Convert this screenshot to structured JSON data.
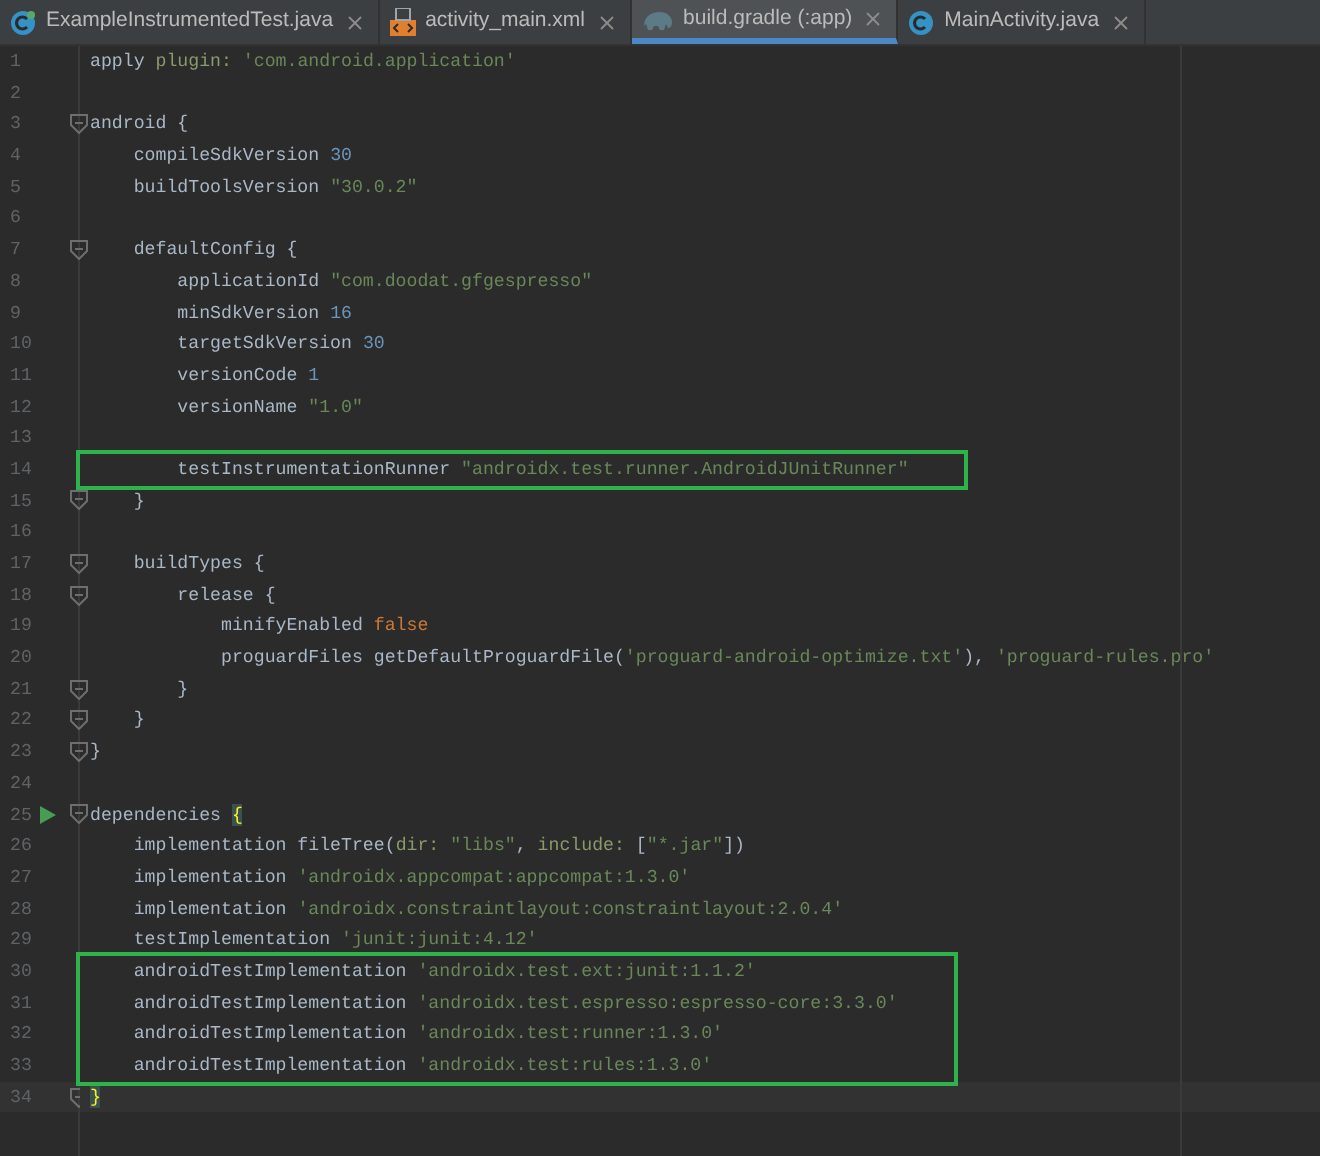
{
  "tabs": [
    {
      "label": "ExampleInstrumentedTest.java",
      "kind": "test-class",
      "selected": false
    },
    {
      "label": "activity_main.xml",
      "kind": "layout",
      "selected": false
    },
    {
      "label": "build.gradle (:app)",
      "kind": "gradle",
      "selected": true
    },
    {
      "label": "MainActivity.java",
      "kind": "class",
      "selected": false
    }
  ],
  "lines": [
    {
      "number": "1",
      "tokens": [
        {
          "kind": "plain",
          "text": "apply "
        },
        {
          "kind": "named",
          "text": "plugin: "
        },
        {
          "kind": "string",
          "text": "'com.android.application'"
        }
      ]
    },
    {
      "number": "2"
    },
    {
      "number": "3",
      "fold": true,
      "tokens": [
        {
          "kind": "plain",
          "text": "android {"
        }
      ]
    },
    {
      "number": "4",
      "tokens": [
        {
          "kind": "plain",
          "text": "    compileSdkVersion "
        },
        {
          "kind": "number",
          "text": "30"
        }
      ]
    },
    {
      "number": "5",
      "tokens": [
        {
          "kind": "plain",
          "text": "    buildToolsVersion "
        },
        {
          "kind": "string",
          "text": "\"30.0.2\""
        }
      ]
    },
    {
      "number": "6"
    },
    {
      "number": "7",
      "fold": true,
      "tokens": [
        {
          "kind": "plain",
          "text": "    defaultConfig {"
        }
      ]
    },
    {
      "number": "8",
      "tokens": [
        {
          "kind": "plain",
          "text": "        applicationId "
        },
        {
          "kind": "string",
          "text": "\"com.doodat.gfgespresso\""
        }
      ]
    },
    {
      "number": "9",
      "tokens": [
        {
          "kind": "plain",
          "text": "        minSdkVersion "
        },
        {
          "kind": "number",
          "text": "16"
        }
      ]
    },
    {
      "number": "10",
      "tokens": [
        {
          "kind": "plain",
          "text": "        targetSdkVersion "
        },
        {
          "kind": "number",
          "text": "30"
        }
      ]
    },
    {
      "number": "11",
      "tokens": [
        {
          "kind": "plain",
          "text": "        versionCode "
        },
        {
          "kind": "number",
          "text": "1"
        }
      ]
    },
    {
      "number": "12",
      "tokens": [
        {
          "kind": "plain",
          "text": "        versionName "
        },
        {
          "kind": "string",
          "text": "\"1.0\""
        }
      ]
    },
    {
      "number": "13"
    },
    {
      "number": "14",
      "boxed": true,
      "tokens": [
        {
          "kind": "plain",
          "text": "        testInstrumentationRunner "
        },
        {
          "kind": "string",
          "text": "\"androidx.test.runner.AndroidJUnitRunner\""
        }
      ]
    },
    {
      "number": "15",
      "fold": true,
      "tokens": [
        {
          "kind": "plain",
          "text": "    }"
        }
      ]
    },
    {
      "number": "16"
    },
    {
      "number": "17",
      "fold": true,
      "tokens": [
        {
          "kind": "plain",
          "text": "    buildTypes {"
        }
      ]
    },
    {
      "number": "18",
      "fold": true,
      "tokens": [
        {
          "kind": "plain",
          "text": "        release {"
        }
      ]
    },
    {
      "number": "19",
      "tokens": [
        {
          "kind": "plain",
          "text": "            minifyEnabled "
        },
        {
          "kind": "keyword",
          "text": "false"
        }
      ]
    },
    {
      "number": "20",
      "tokens": [
        {
          "kind": "plain",
          "text": "            proguardFiles getDefaultProguardFile("
        },
        {
          "kind": "string",
          "text": "'proguard-android-optimize.txt'"
        },
        {
          "kind": "plain",
          "text": "), "
        },
        {
          "kind": "string",
          "text": "'proguard-rules.pro'"
        }
      ]
    },
    {
      "number": "21",
      "fold": true,
      "tokens": [
        {
          "kind": "plain",
          "text": "        }"
        }
      ]
    },
    {
      "number": "22",
      "fold": true,
      "tokens": [
        {
          "kind": "plain",
          "text": "    }"
        }
      ]
    },
    {
      "number": "23",
      "fold": true,
      "tokens": [
        {
          "kind": "plain",
          "text": "}"
        }
      ]
    },
    {
      "number": "24"
    },
    {
      "number": "25",
      "fold": true,
      "run": true,
      "tokens": [
        {
          "kind": "plain",
          "text": "dependencies "
        },
        {
          "kind": "brace",
          "text": "{"
        }
      ]
    },
    {
      "number": "26",
      "tokens": [
        {
          "kind": "plain",
          "text": "    implementation fileTree("
        },
        {
          "kind": "named",
          "text": "dir: "
        },
        {
          "kind": "string",
          "text": "\"libs\""
        },
        {
          "kind": "plain",
          "text": ", "
        },
        {
          "kind": "named",
          "text": "include:"
        },
        {
          "kind": "plain",
          "text": " ["
        },
        {
          "kind": "string",
          "text": "\"*.jar\""
        },
        {
          "kind": "plain",
          "text": "])"
        }
      ]
    },
    {
      "number": "27",
      "tokens": [
        {
          "kind": "plain",
          "text": "    implementation "
        },
        {
          "kind": "string",
          "text": "'androidx.appcompat:appcompat:1.3.0'"
        }
      ]
    },
    {
      "number": "28",
      "tokens": [
        {
          "kind": "plain",
          "text": "    implementation "
        },
        {
          "kind": "string",
          "text": "'androidx.constraintlayout:constraintlayout:2.0.4'"
        }
      ]
    },
    {
      "number": "29",
      "tokens": [
        {
          "kind": "plain",
          "text": "    testImplementation "
        },
        {
          "kind": "string",
          "text": "'junit:junit:4.12'"
        }
      ]
    },
    {
      "number": "30",
      "boxed": true,
      "tokens": [
        {
          "kind": "plain",
          "text": "    androidTestImplementation "
        },
        {
          "kind": "string",
          "text": "'androidx.test.ext:junit:1.1.2'"
        }
      ]
    },
    {
      "number": "31",
      "boxed": true,
      "tokens": [
        {
          "kind": "plain",
          "text": "    androidTestImplementation "
        },
        {
          "kind": "string",
          "text": "'androidx.test.espresso:espresso-core:3.3.0'"
        }
      ]
    },
    {
      "number": "32",
      "boxed": true,
      "tokens": [
        {
          "kind": "plain",
          "text": "    androidTestImplementation "
        },
        {
          "kind": "string",
          "text": "'androidx.test:runner:1.3.0'"
        }
      ]
    },
    {
      "number": "33",
      "boxed": true,
      "tokens": [
        {
          "kind": "plain",
          "text": "    androidTestImplementation "
        },
        {
          "kind": "string",
          "text": "'androidx.test:rules:1.3.0'"
        }
      ]
    },
    {
      "number": "34",
      "fold": true,
      "current": true,
      "tokens": [
        {
          "kind": "brace",
          "text": "}"
        }
      ]
    }
  ]
}
